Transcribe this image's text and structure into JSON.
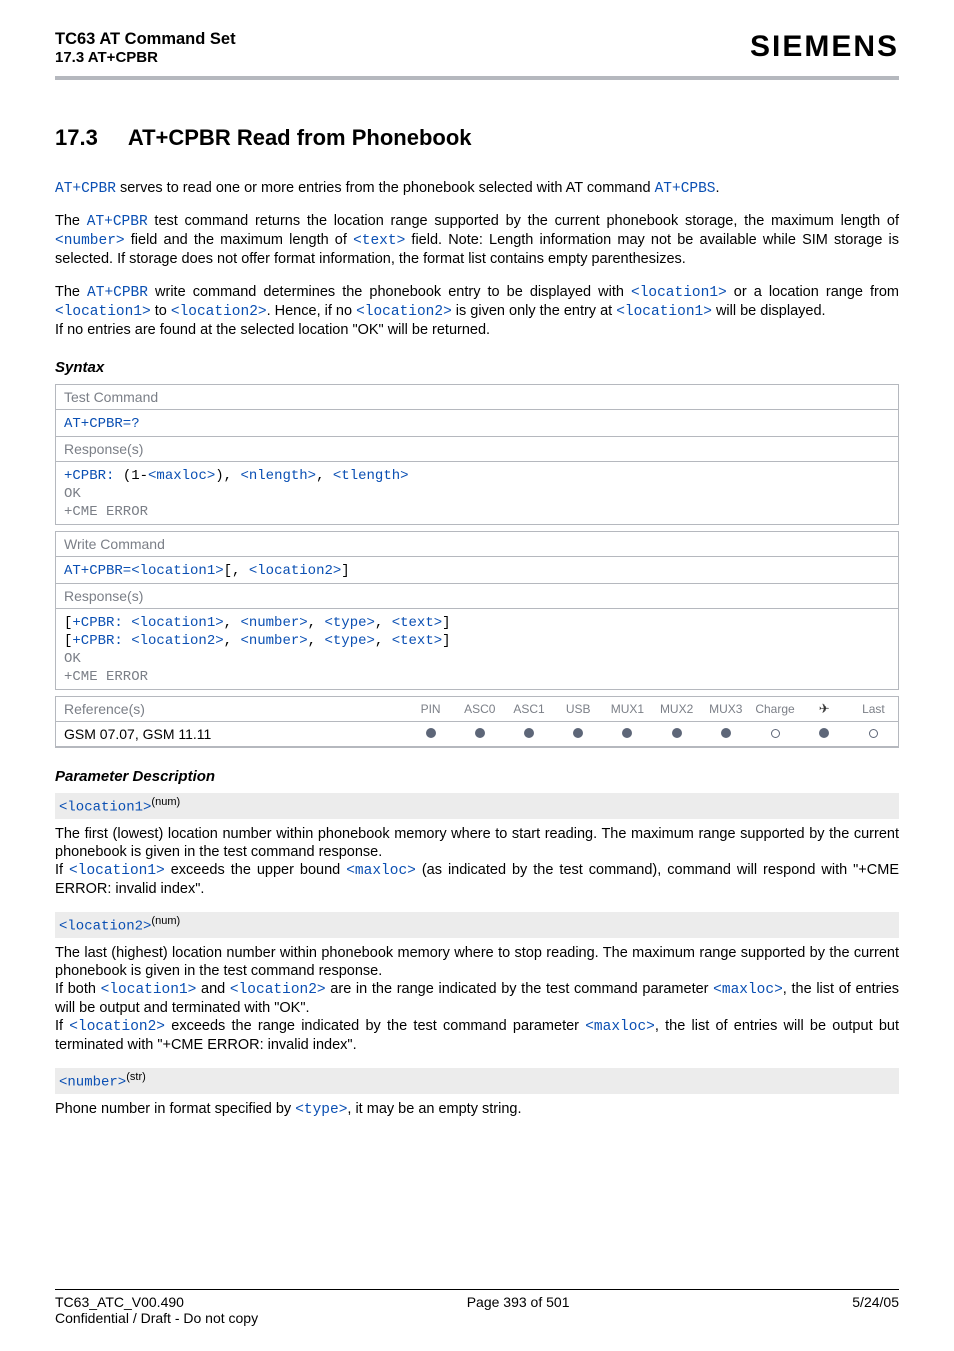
{
  "header": {
    "title": "TC63 AT Command Set",
    "subtitle": "17.3 AT+CPBR",
    "brand": "SIEMENS"
  },
  "section": {
    "num": "17.3",
    "title": "AT+CPBR   Read from Phonebook"
  },
  "intro": {
    "p1a": "AT+CPBR",
    "p1b": " serves to read one or more entries from the phonebook selected with AT command ",
    "p1c": "AT+CPBS",
    "p1d": ".",
    "p2a": "The ",
    "p2b": "AT+CPBR",
    "p2c": " test command returns the location range supported by the current phonebook storage, the maximum length of ",
    "p2d": "<number>",
    "p2e": " field and the maximum length of ",
    "p2f": "<text>",
    "p2g": " field. Note: Length information may not be available while SIM storage is selected. If storage does not offer format information, the format list contains empty parenthesizes.",
    "p3a": "The ",
    "p3b": "AT+CPBR",
    "p3c": " write command determines the phonebook entry to be displayed with ",
    "p3d": "<location1>",
    "p3e": " or a location range from ",
    "p3f": "<location1>",
    "p3g": " to ",
    "p3h": "<location2>",
    "p3i": ". Hence, if no ",
    "p3j": "<location2>",
    "p3k": " is given only the entry at ",
    "p3l": "<location1>",
    "p3m": " will be displayed.",
    "p3n": "If no entries are found at the selected location \"OK\" will be returned."
  },
  "syntax": {
    "label": "Syntax",
    "test_command": "Test Command",
    "test_cmd": "AT+CPBR=?",
    "responses": "Response(s)",
    "test_resp1a": "+CPBR: ",
    "test_resp1b": "(1-",
    "test_resp1c": "<maxloc>",
    "test_resp1d": "), ",
    "test_resp1e": "<nlength>",
    "test_resp1f": ", ",
    "test_resp1g": "<tlength>",
    "ok": "OK",
    "cme": "+CME ERROR",
    "write_command": "Write Command",
    "write_cmd_a": "AT+CPBR=",
    "write_cmd_b": "<location1>",
    "write_cmd_c": "[, ",
    "write_cmd_d": "<location2>",
    "write_cmd_e": "]",
    "write_resp1a": "[",
    "write_resp1b": "+CPBR: ",
    "write_resp1c": "<location1>",
    "write_resp1d": ", ",
    "write_resp1e": "<number>",
    "write_resp1f": ", ",
    "write_resp1g": "<type>",
    "write_resp1h": ", ",
    "write_resp1i": "<text>",
    "write_resp1j": "]",
    "write_resp2c": "<location2>"
  },
  "refs": {
    "label": "Reference(s)",
    "value": "GSM 07.07, GSM 11.11",
    "cols": [
      "PIN",
      "ASC0",
      "ASC1",
      "USB",
      "MUX1",
      "MUX2",
      "MUX3",
      "Charge",
      "✈",
      "Last"
    ]
  },
  "parm": {
    "label": "Parameter Description",
    "loc1": "<location1>",
    "num_sup": "(num)",
    "loc1_d1": "The first (lowest) location number within phonebook memory where to start reading. The maximum range supported by the current phonebook is given in the test command response.",
    "loc1_d2a": "If ",
    "loc1_d2b": "<location1>",
    "loc1_d2c": " exceeds the upper bound ",
    "loc1_d2d": "<maxloc>",
    "loc1_d2e": " (as indicated by the test command), command will respond with \"+CME ERROR: invalid index\".",
    "loc2": "<location2>",
    "loc2_d1": "The last (highest) location number within phonebook memory where to stop reading. The maximum range supported by the current phonebook is given in the test command response.",
    "loc2_d2a": "If both ",
    "loc2_d2b": "<location1>",
    "loc2_d2c": " and ",
    "loc2_d2d": "<location2>",
    "loc2_d2e": " are in the range indicated by the test command parameter ",
    "loc2_d2f": "<maxloc>",
    "loc2_d2g": ", the list of entries will be output and terminated with \"OK\".",
    "loc2_d3a": "If ",
    "loc2_d3b": "<location2>",
    "loc2_d3c": " exceeds the range indicated by the test command parameter ",
    "loc2_d3d": "<maxloc>",
    "loc2_d3e": ", the list of entries will be output but terminated with \"+CME ERROR: invalid index\".",
    "number": "<number>",
    "str_sup": "(str)",
    "number_d1a": "Phone number in format specified by ",
    "number_d1b": "<type>",
    "number_d1c": ", it may be an empty string."
  },
  "footer": {
    "left": "TC63_ATC_V00.490",
    "center": "Page 393 of 501",
    "right": "5/24/05",
    "left2": "Confidential / Draft - Do not copy"
  }
}
